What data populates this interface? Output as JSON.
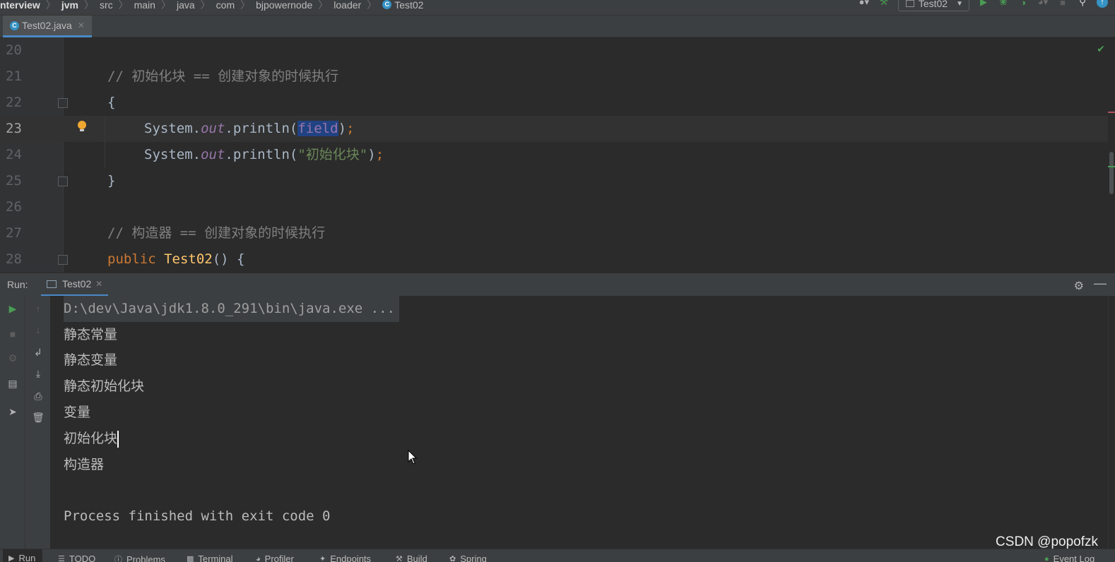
{
  "navbar": {
    "breadcrumbs": [
      "nterview",
      "jvm",
      "src",
      "main",
      "java",
      "com",
      "bjpowernode",
      "loader",
      "Test02"
    ],
    "run_config": "Test02"
  },
  "editor_tab": {
    "label": "Test02.java"
  },
  "editor": {
    "lines": [
      {
        "num": "20"
      },
      {
        "num": "21",
        "comment": "// 初始化块 == 创建对象的时候执行"
      },
      {
        "num": "22",
        "brace": "{"
      },
      {
        "num": "23",
        "p1": "System.",
        "p2": "out",
        "p3": ".println(",
        "sel": "field",
        "p4": ")",
        "p5": ";"
      },
      {
        "num": "24",
        "p1": "System.",
        "p2": "out",
        "p3": ".println(",
        "str": "\"初始化块\"",
        "p4": ")",
        "p5": ";"
      },
      {
        "num": "25",
        "brace": "}"
      },
      {
        "num": "26"
      },
      {
        "num": "27",
        "comment": "// 构造器 == 创建对象的时候执行"
      },
      {
        "num": "28",
        "kw": "public",
        "fn": "Test02",
        "rest": "() {"
      }
    ]
  },
  "run": {
    "label": "Run:",
    "tab": "Test02",
    "console": [
      "D:\\dev\\Java\\jdk1.8.0_291\\bin\\java.exe ...",
      "静态常量",
      "静态变量",
      "静态初始化块",
      "变量",
      "初始化块",
      "构造器",
      "",
      "Process finished with exit code 0"
    ]
  },
  "bottom_bar": [
    "Run",
    "TODO",
    "Problems",
    "Terminal",
    "Profiler",
    "Endpoints",
    "Build",
    "Spring",
    "Event Log"
  ],
  "watermark": "CSDN @popofzk",
  "colors": {
    "accent": "#4a88c7",
    "keyword": "#cc7832",
    "string": "#6a8759",
    "comment": "#808080",
    "field": "#9876aa",
    "function": "#ffc66d"
  }
}
